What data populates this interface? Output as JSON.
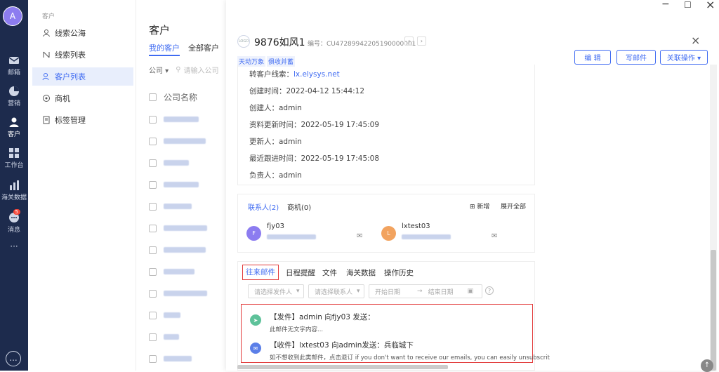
{
  "rail": {
    "avatar": "A",
    "items": [
      {
        "label": "邮箱",
        "icon": "mail-icon"
      },
      {
        "label": "营销",
        "icon": "pie-chart-icon"
      },
      {
        "label": "客户",
        "icon": "user-icon"
      },
      {
        "label": "工作台",
        "icon": "grid-icon"
      },
      {
        "label": "海关数据",
        "icon": "bar-chart-icon"
      },
      {
        "label": "消息",
        "icon": "message-icon",
        "badge": "5"
      },
      {
        "label": "···",
        "icon": "more-icon"
      }
    ],
    "bottom_icon": "..."
  },
  "side": {
    "title": "客户",
    "items": [
      {
        "label": "线索公海",
        "icon": "user-outline-icon"
      },
      {
        "label": "线索列表",
        "icon": "leads-icon"
      },
      {
        "label": "客户列表",
        "icon": "users-icon",
        "active": true
      },
      {
        "label": "商机",
        "icon": "opportunity-icon"
      },
      {
        "label": "标签管理",
        "icon": "tag-icon"
      }
    ]
  },
  "list": {
    "title": "客户",
    "tabs": [
      "我的客户",
      "全部客户"
    ],
    "filter_select": "公司",
    "search_placeholder": "请输入公司",
    "column_header": "公司名称",
    "row_count": 12
  },
  "window": {
    "minimize": "−",
    "maximize": "☐",
    "close": "×"
  },
  "detail": {
    "logo_text": "LOGO",
    "name": "9876如风1",
    "code_label": "编号：CU47289942205190000001",
    "tags": [
      "天动万象",
      "俱收并蓄"
    ],
    "buttons": {
      "edit": "编 辑",
      "write_mail": "写邮件",
      "related": "关联操作 ▾"
    },
    "close": "×",
    "info": [
      {
        "label": "转客户线索：",
        "value": "lx.elysys.net",
        "link": true
      },
      {
        "label": "创建时间：",
        "value": "2022-04-12 15:44:12"
      },
      {
        "label": "创建人：",
        "value": "admin"
      },
      {
        "label": "资料更新时间：",
        "value": "2022-05-19 17:45:09"
      },
      {
        "label": "更新人：",
        "value": "admin"
      },
      {
        "label": "最近跟进时间：",
        "value": "2022-05-19 17:45:08"
      },
      {
        "label": "负责人：",
        "value": "admin"
      }
    ],
    "contacts": {
      "tabs": [
        "联系人(2)",
        "商机(0)"
      ],
      "add": "新增",
      "expand": "展开全部",
      "people": [
        {
          "name": "fjy03",
          "avatar": "F",
          "color": "#8c7cf0"
        },
        {
          "name": "lxtest03",
          "avatar": "L",
          "color": "#f2a35f"
        }
      ]
    },
    "mail": {
      "tabs": [
        "往来邮件",
        "日程提醒",
        "文件",
        "海关数据",
        "操作历史"
      ],
      "filters": {
        "sender": "请选择发件人",
        "contact": "请选择联系人",
        "start": "开始日期",
        "arrow": "→",
        "end": "结束日期"
      },
      "items": [
        {
          "subject": "【发件】admin 向fjy03 发送：",
          "body": "此邮件无文字内容...",
          "color": "#5ec29a",
          "icon": "send-icon"
        },
        {
          "subject": "【收件】lxtest03 向admin发送：兵临城下",
          "body": "如不想收到此类邮件，点击退订 if you don't want to receive our emails, you can easily unsubscrit",
          "color": "#5b7fe8",
          "icon": "inbox-icon"
        }
      ]
    }
  }
}
